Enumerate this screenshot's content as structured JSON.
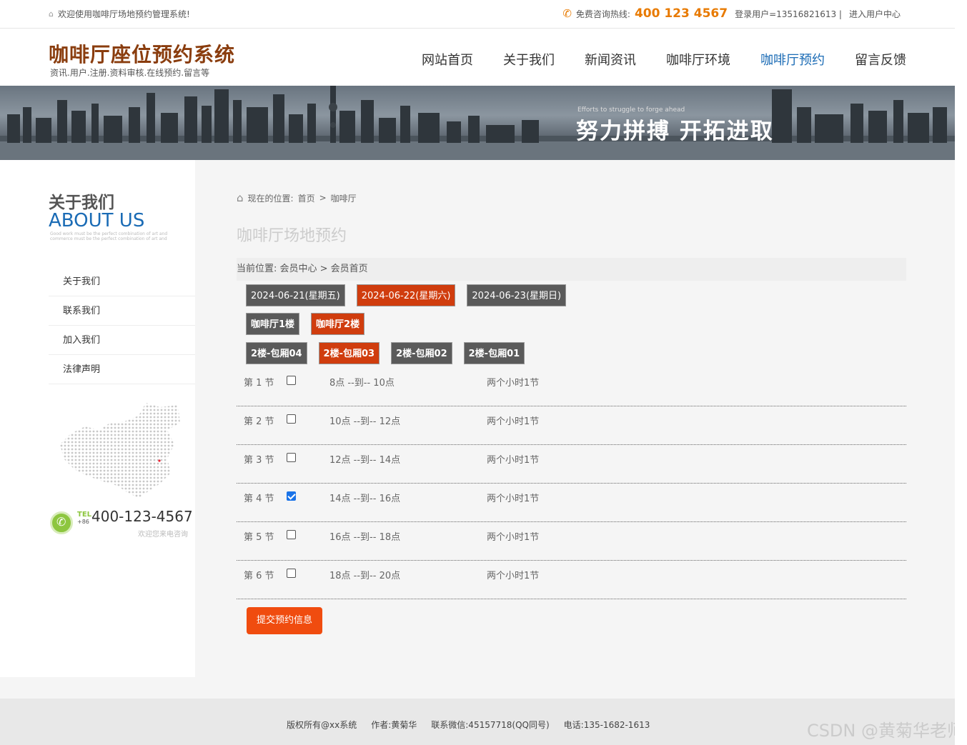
{
  "topbar": {
    "welcome": "欢迎使用咖啡厅场地预约管理系统!",
    "hotline_label": "免费咨询热线:",
    "hotline_number": "400 123 4567",
    "login_user": "登录用户=13516821613 |",
    "user_center": "进入用户中心"
  },
  "header": {
    "title": "咖啡厅座位预约系统",
    "subtitle": "资讯.用户.注册.资料审核.在线预约.留言等",
    "nav": [
      "网站首页",
      "关于我们",
      "新闻资讯",
      "咖啡厅环境",
      "咖啡厅预约",
      "留言反馈"
    ],
    "nav_active_index": 4
  },
  "banner": {
    "small": "Efforts to struggle to forge ahead",
    "slogan": "努力拼搏 开拓进取"
  },
  "sidebar": {
    "title_cn": "关于我们",
    "title_en": "ABOUT US",
    "small_text": "Good work must be the perfect combination of art and commerce must be the perfect combination of art and",
    "menu": [
      "关于我们",
      "联系我们",
      "加入我们",
      "法律声明"
    ],
    "tel_label": "TEL",
    "tel_prefix": "+86",
    "tel_number": "400-123-4567",
    "tel_sub": "欢迎您来电咨询"
  },
  "content": {
    "crumb_label": "现在的位置:",
    "crumb_home": "首页",
    "crumb_arrow": ">",
    "crumb_current": "咖啡厅",
    "page_heading": "咖啡厅场地预约",
    "position_bar": "当前位置:  会员中心 > 会员首页",
    "dates": [
      {
        "label": "2024-06-21(星期五)",
        "active": false
      },
      {
        "label": "2024-06-22(星期六)",
        "active": true
      },
      {
        "label": "2024-06-23(星期日)",
        "active": false
      }
    ],
    "floors": [
      {
        "label": "咖啡厅1楼",
        "active": false
      },
      {
        "label": "咖啡厅2楼",
        "active": true
      }
    ],
    "rooms": [
      {
        "label": "2楼-包厢04",
        "active": false
      },
      {
        "label": "2楼-包厢03",
        "active": true
      },
      {
        "label": "2楼-包厢02",
        "active": false
      },
      {
        "label": "2楼-包厢01",
        "active": false
      }
    ],
    "slots": [
      {
        "label": "第 1 节",
        "time": "8点 --到-- 10点",
        "duration": "两个小时1节",
        "checked": false
      },
      {
        "label": "第 2 节",
        "time": "10点 --到-- 12点",
        "duration": "两个小时1节",
        "checked": false
      },
      {
        "label": "第 3 节",
        "time": "12点 --到-- 14点",
        "duration": "两个小时1节",
        "checked": false
      },
      {
        "label": "第 4 节",
        "time": "14点 --到-- 16点",
        "duration": "两个小时1节",
        "checked": true
      },
      {
        "label": "第 5 节",
        "time": "16点 --到-- 18点",
        "duration": "两个小时1节",
        "checked": false
      },
      {
        "label": "第 6 节",
        "time": "18点 --到-- 20点",
        "duration": "两个小时1节",
        "checked": false
      }
    ],
    "submit_label": "提交预约信息"
  },
  "footer": {
    "copyright": "版权所有@xx系统",
    "author": "作者:黄菊华",
    "wechat": "联系微信:45157718(QQ同号)",
    "phone": "电话:135-1682-1613"
  },
  "watermark": "CSDN @黄菊华老师"
}
